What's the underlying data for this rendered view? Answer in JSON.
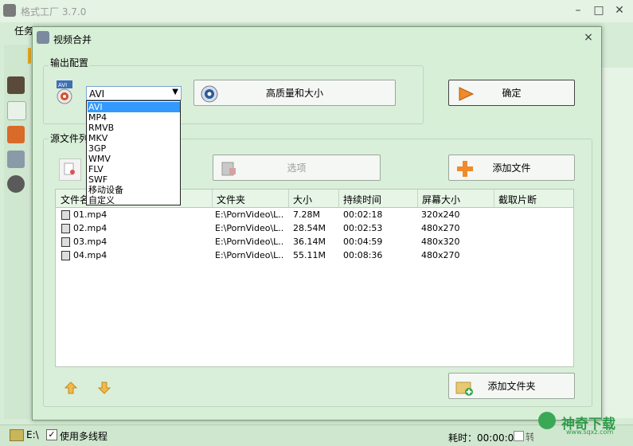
{
  "app": {
    "title": "格式工厂 3.7.0",
    "menu_task": "任务"
  },
  "status": {
    "drive": "E:\\",
    "multithread_checked": "✓",
    "multithread_label": "使用多线程",
    "elapsed": "耗时：00:00:00",
    "shutdown_label": "转换完成后关闭电脑"
  },
  "dialog": {
    "title": "视频合并",
    "close": "×",
    "output_group_label": "输出配置",
    "source_group_label": "源文件列表",
    "quality_button": "高质量和大小",
    "ok_button": "确定",
    "options_button": "选项",
    "add_file_button": "添加文件",
    "add_folder_button": "添加文件夹"
  },
  "format_select": {
    "value": "AVI",
    "arrow": "▼",
    "options": [
      "AVI",
      "MP4",
      "RMVB",
      "MKV",
      "3GP",
      "WMV",
      "FLV",
      "SWF",
      "移动设备",
      "自定义"
    ]
  },
  "table": {
    "headers": [
      "文件名",
      "文件夹",
      "大小",
      "持续时间",
      "屏幕大小",
      "截取片断"
    ],
    "rows": [
      {
        "name": "01.mp4",
        "folder": "E:\\PornVideo\\L...",
        "size": "7.28M",
        "duration": "00:02:18",
        "screen": "320x240"
      },
      {
        "name": "02.mp4",
        "folder": "E:\\PornVideo\\L...",
        "size": "28.54M",
        "duration": "00:02:53",
        "screen": "480x270"
      },
      {
        "name": "03.mp4",
        "folder": "E:\\PornVideo\\L...",
        "size": "36.14M",
        "duration": "00:04:59",
        "screen": "480x320"
      },
      {
        "name": "04.mp4",
        "folder": "E:\\PornVideo\\L...",
        "size": "55.11M",
        "duration": "00:08:36",
        "screen": "480x270"
      }
    ]
  },
  "watermark": {
    "text": "神奇下载",
    "sub": "www.sqxz.com"
  },
  "colors": {
    "dialog_bg": "#d7eed7",
    "selection": "#3399ff",
    "watermark": "#2f9b4a"
  }
}
